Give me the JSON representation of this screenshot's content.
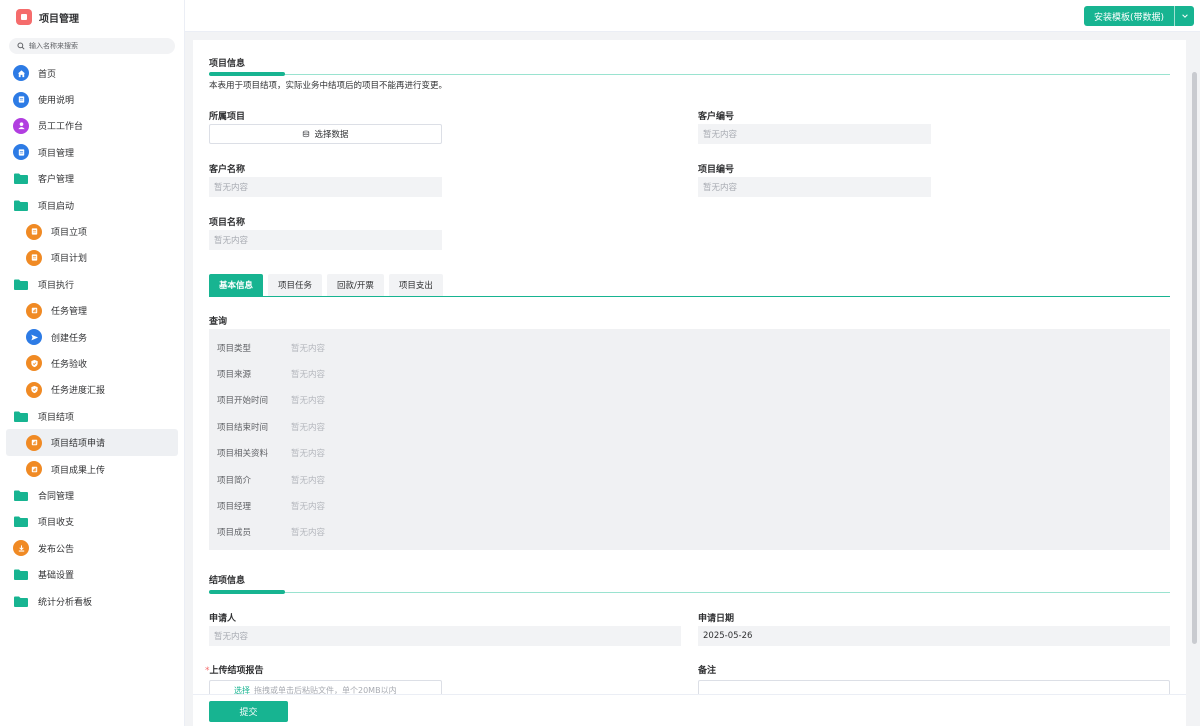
{
  "app": {
    "title": "项目管理"
  },
  "search": {
    "placeholder": "输入名称来搜索"
  },
  "sidebar": {
    "items": [
      {
        "label": "首页"
      },
      {
        "label": "使用说明"
      },
      {
        "label": "员工工作台"
      },
      {
        "label": "项目管理"
      },
      {
        "label": "客户管理"
      },
      {
        "label": "项目启动"
      },
      {
        "label": "项目立项"
      },
      {
        "label": "项目计划"
      },
      {
        "label": "项目执行"
      },
      {
        "label": "任务管理"
      },
      {
        "label": "创建任务"
      },
      {
        "label": "任务验收"
      },
      {
        "label": "任务进度汇报"
      },
      {
        "label": "项目结项"
      },
      {
        "label": "项目结项申请"
      },
      {
        "label": "项目成果上传"
      },
      {
        "label": "合同管理"
      },
      {
        "label": "项目收支"
      },
      {
        "label": "发布公告"
      },
      {
        "label": "基础设置"
      },
      {
        "label": "统计分析看板"
      }
    ]
  },
  "topbar": {
    "install_label": "安装模板(带数据)"
  },
  "project_info": {
    "title": "项目信息",
    "note": "本表用于项目结项，实际业务中结项后的项目不能再进行变更。",
    "belong_label": "所属项目",
    "select_label": "选择数据",
    "customer_code_label": "客户编号",
    "customer_name_label": "客户名称",
    "project_code_label": "项目编号",
    "project_name_label": "项目名称",
    "empty": "暂无内容"
  },
  "tabs": [
    {
      "label": "基本信息"
    },
    {
      "label": "项目任务"
    },
    {
      "label": "回款/开票"
    },
    {
      "label": "项目支出"
    }
  ],
  "query": {
    "title": "查询",
    "rows": [
      {
        "key": "项目类型",
        "value": "暂无内容"
      },
      {
        "key": "项目来源",
        "value": "暂无内容"
      },
      {
        "key": "项目开始时间",
        "value": "暂无内容"
      },
      {
        "key": "项目结束时间",
        "value": "暂无内容"
      },
      {
        "key": "项目相关资料",
        "value": "暂无内容"
      },
      {
        "key": "项目简介",
        "value": "暂无内容"
      },
      {
        "key": "项目经理",
        "value": "暂无内容"
      },
      {
        "key": "项目成员",
        "value": "暂无内容"
      }
    ]
  },
  "closing": {
    "title": "结项信息",
    "applicant_label": "申请人",
    "applicant_value": "暂无内容",
    "date_label": "申请日期",
    "date_value": "2025-05-26",
    "upload_label": "上传结项报告",
    "upload_pick": "选择",
    "upload_hint": "拖拽或单击后粘贴文件，单个20MB以内",
    "remark_label": "备注"
  },
  "footer": {
    "submit_label": "提交"
  },
  "colors": {
    "accent": "#17b491",
    "nav_blue": "#2d7be5",
    "nav_orange": "#f08a24",
    "nav_purple": "#b13ee0",
    "danger": "#f56c6c"
  }
}
